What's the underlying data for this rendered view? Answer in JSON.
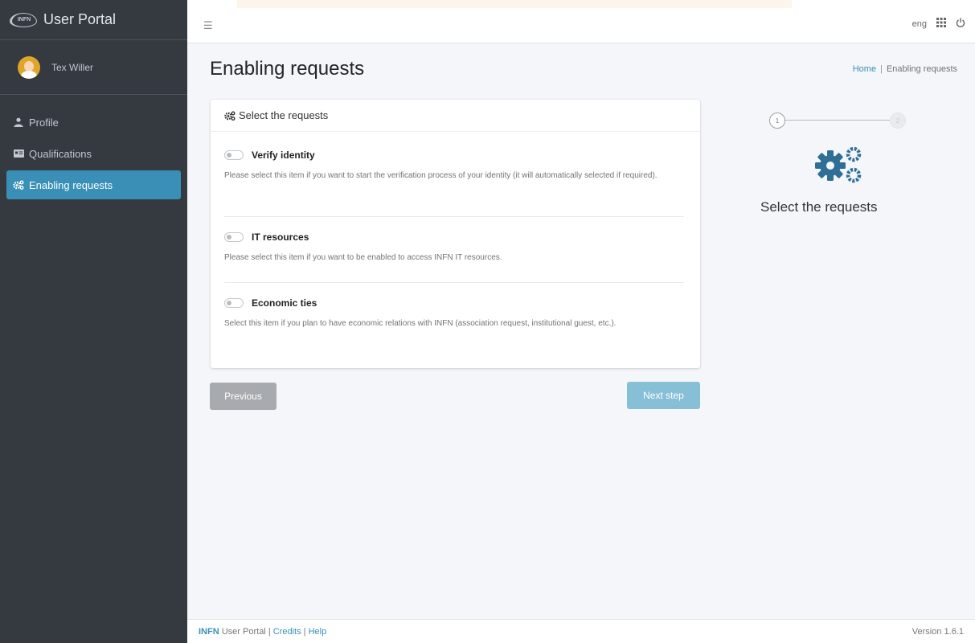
{
  "app": {
    "brand_logo_text": "INFN",
    "brand_name": "User Portal"
  },
  "user": {
    "name": "Tex Willer"
  },
  "sidebar": {
    "items": [
      {
        "label": "Profile",
        "icon": "user-icon",
        "active": false
      },
      {
        "label": "Qualifications",
        "icon": "id-card-icon",
        "active": false
      },
      {
        "label": "Enabling requests",
        "icon": "cogs-icon",
        "active": true
      }
    ]
  },
  "topbar": {
    "menu_icon": "hamburger-icon",
    "language": "eng",
    "apps_icon": "grid-icon",
    "power_icon": "power-icon"
  },
  "page": {
    "title": "Enabling requests",
    "breadcrumb": {
      "home": "Home",
      "separator": "|",
      "current": "Enabling requests"
    }
  },
  "card": {
    "header": "Select the requests",
    "requests": [
      {
        "title": "Verify identity",
        "description": "Please select this item if you want to start the verification process of your identity (it will automatically selected if required).",
        "enabled": false
      },
      {
        "title": "IT resources",
        "description": "Please select this item if you want to be enabled to access INFN IT resources.",
        "enabled": false
      },
      {
        "title": "Economic ties",
        "description": "Select this item if you plan to have economic relations with INFN (association request, institutional guest, etc.).",
        "enabled": false
      }
    ]
  },
  "buttons": {
    "previous": "Previous",
    "next": "Next step"
  },
  "stepper": {
    "step1": "1",
    "step2": "2",
    "current_title": "Select the requests"
  },
  "footer": {
    "brand": "INFN",
    "app": "User Portal",
    "sep1": "|",
    "credits": "Credits",
    "sep2": "|",
    "help": "Help",
    "version": "Version 1.6.1"
  },
  "colors": {
    "sidebar_bg": "#343a40",
    "accent": "#3a8fb7",
    "next_button": "#86bfd6",
    "previous_button": "#a7abaf"
  }
}
